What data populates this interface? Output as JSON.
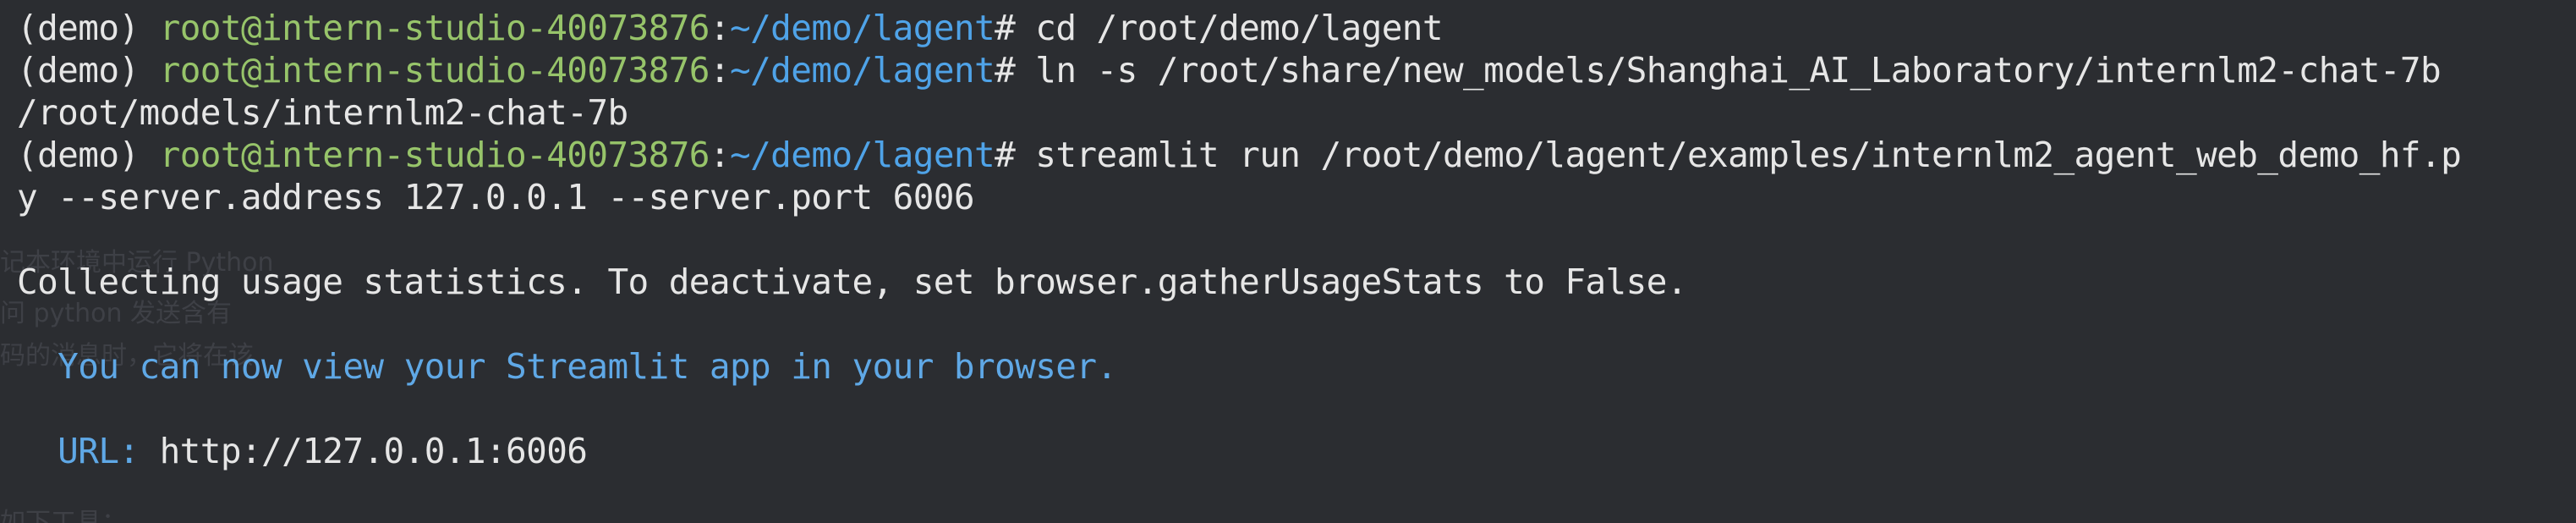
{
  "terminal": {
    "prompt": {
      "env": "(demo)",
      "user_host": "root@intern-studio-40073876",
      "separator": ":",
      "path": "~/demo/lagent",
      "symbol": "#"
    },
    "lines": [
      {
        "type": "prompt",
        "command": "cd /root/demo/lagent"
      },
      {
        "type": "prompt",
        "command": "ln -s /root/share/new_models/Shanghai_AI_Laboratory/internlm2-chat-7b"
      },
      {
        "type": "output",
        "text": "/root/models/internlm2-chat-7b"
      },
      {
        "type": "prompt",
        "command": "streamlit run /root/demo/lagent/examples/internlm2_agent_web_demo_hf.p"
      },
      {
        "type": "output",
        "text": "y --server.address 127.0.0.1 --server.port 6006"
      },
      {
        "type": "blank"
      },
      {
        "type": "output",
        "text": "Collecting usage statistics. To deactivate, set browser.gatherUsageStats to False."
      },
      {
        "type": "blank"
      },
      {
        "type": "blank"
      },
      {
        "type": "info",
        "text": "  You can now view your Streamlit app in your browser."
      },
      {
        "type": "blank"
      },
      {
        "type": "url",
        "label": "  URL:",
        "value": " http://127.0.0.1:6006"
      }
    ]
  },
  "background_ghost": [
    "记本环境中运行 Python",
    "问 python 发送含有",
    "码的消息时，它将在该",
    "如下工具："
  ],
  "colors": {
    "background": "#2b2d31",
    "user_host": "#97c46a",
    "path": "#4fa3e8",
    "info": "#5fa8e6",
    "text": "#e6e6e6"
  }
}
